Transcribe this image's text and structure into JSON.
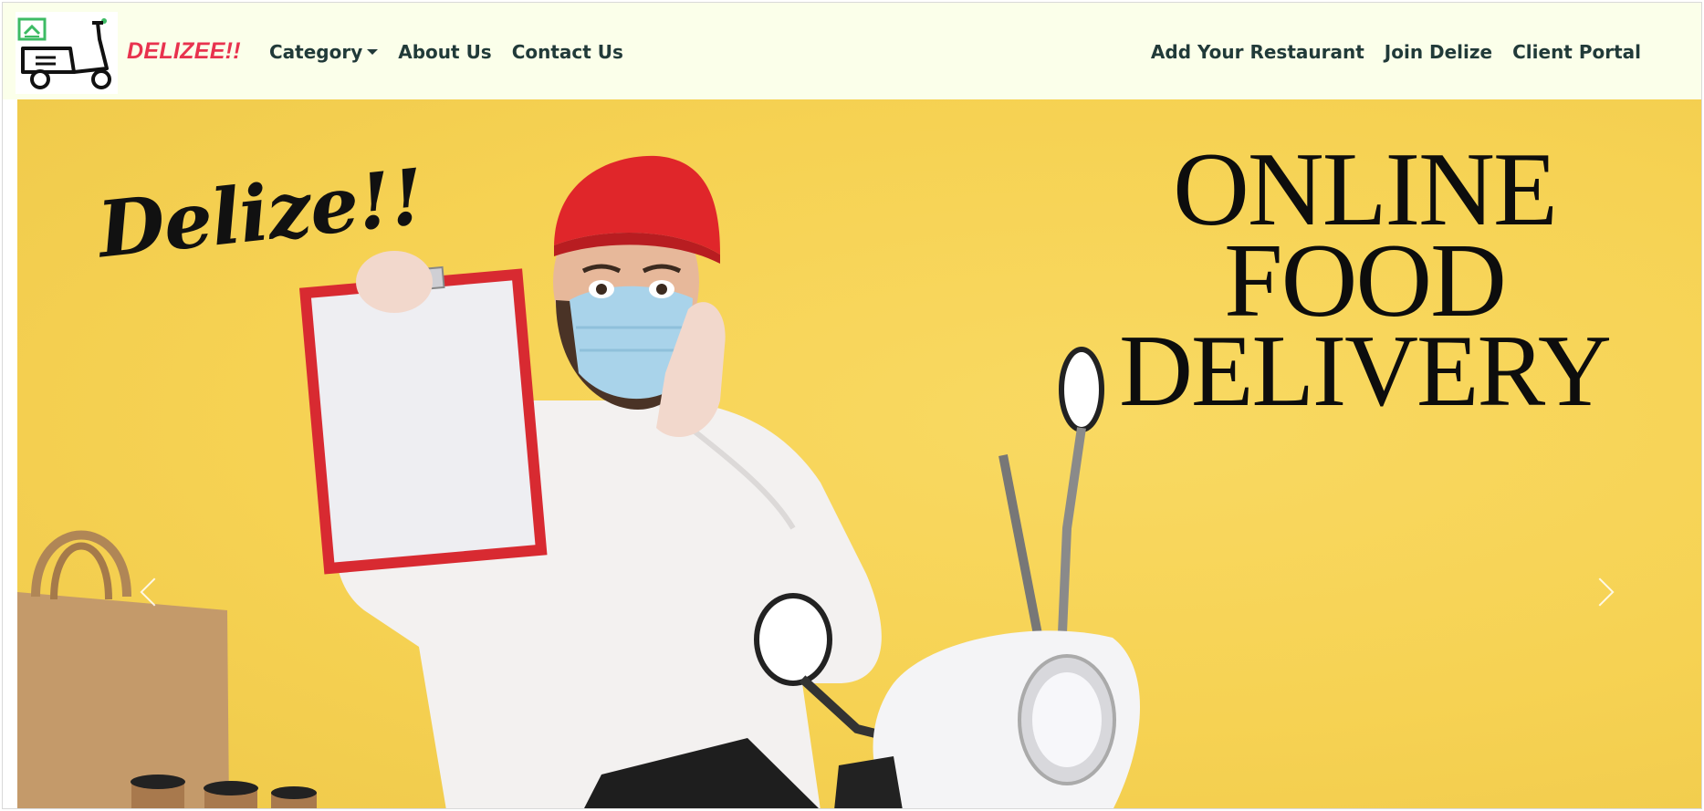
{
  "navbar": {
    "brand_name": "DELIZEE!!",
    "logo_icon": "scooter-delivery-icon",
    "left_links": [
      {
        "label": "Category",
        "dropdown": true
      },
      {
        "label": "About Us"
      },
      {
        "label": "Contact Us"
      }
    ],
    "right_links": [
      {
        "label": "Add Your Restaurant"
      },
      {
        "label": "Join Delize"
      },
      {
        "label": "Client Portal"
      }
    ]
  },
  "hero": {
    "script_text": "Delize!!",
    "headline": [
      "ONLINE",
      "FOOD",
      "DELIVERY"
    ]
  },
  "colors": {
    "navbar_bg": "#fbffea",
    "brand": "#e8324e",
    "nav_text": "#213a39",
    "hero_bg": "#f6d253"
  }
}
